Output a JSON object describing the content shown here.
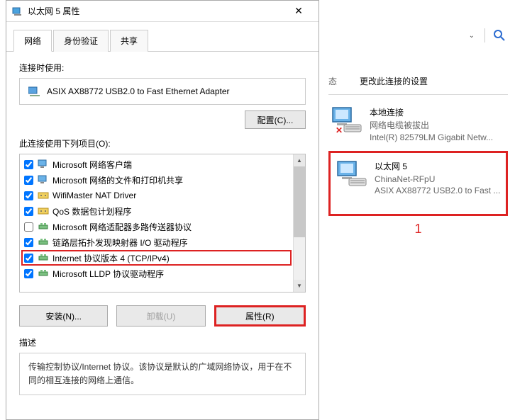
{
  "dialog": {
    "title": "以太网 5 属性",
    "tabs": [
      "网络",
      "身份验证",
      "共享"
    ],
    "connection_label": "连接时使用:",
    "adapter": "ASIX AX88772 USB2.0 to Fast Ethernet Adapter",
    "configure_btn": "配置(C)...",
    "items_label": "此连接使用下列项目(O):",
    "protocols": [
      {
        "checked": true,
        "label": "Microsoft 网络客户端",
        "icon": "client"
      },
      {
        "checked": true,
        "label": "Microsoft 网络的文件和打印机共享",
        "icon": "client"
      },
      {
        "checked": true,
        "label": "WifiMaster NAT Driver",
        "icon": "driver"
      },
      {
        "checked": true,
        "label": "QoS 数据包计划程序",
        "icon": "driver"
      },
      {
        "checked": false,
        "label": "Microsoft 网络适配器多路传送器协议",
        "icon": "proto"
      },
      {
        "checked": true,
        "label": "链路层拓扑发现映射器 I/O 驱动程序",
        "icon": "proto"
      },
      {
        "checked": true,
        "label": "Internet 协议版本 4 (TCP/IPv4)",
        "icon": "proto",
        "selected": true
      },
      {
        "checked": true,
        "label": "Microsoft LLDP 协议驱动程序",
        "icon": "proto"
      }
    ],
    "install_btn": "安装(N)...",
    "uninstall_btn": "卸载(U)",
    "props_btn": "属性(R)",
    "desc_label": "描述",
    "desc_text": "传输控制协议/Internet 协议。该协议是默认的广域网络协议，用于在不同的相互连接的网络上通信。"
  },
  "right": {
    "section_mod": "更改此连接的设置",
    "partial_letter": "态",
    "connections": [
      {
        "name": "本地连接",
        "status": "网络电缆被拔出",
        "detail": "Intel(R) 82579LM Gigabit Netw...",
        "disconnected": true
      },
      {
        "name": "以太网 5",
        "status": "ChinaNet-RFpU",
        "detail": "ASIX AX88772 USB2.0 to Fast ...",
        "highlighted": true
      }
    ],
    "marker": "1"
  }
}
